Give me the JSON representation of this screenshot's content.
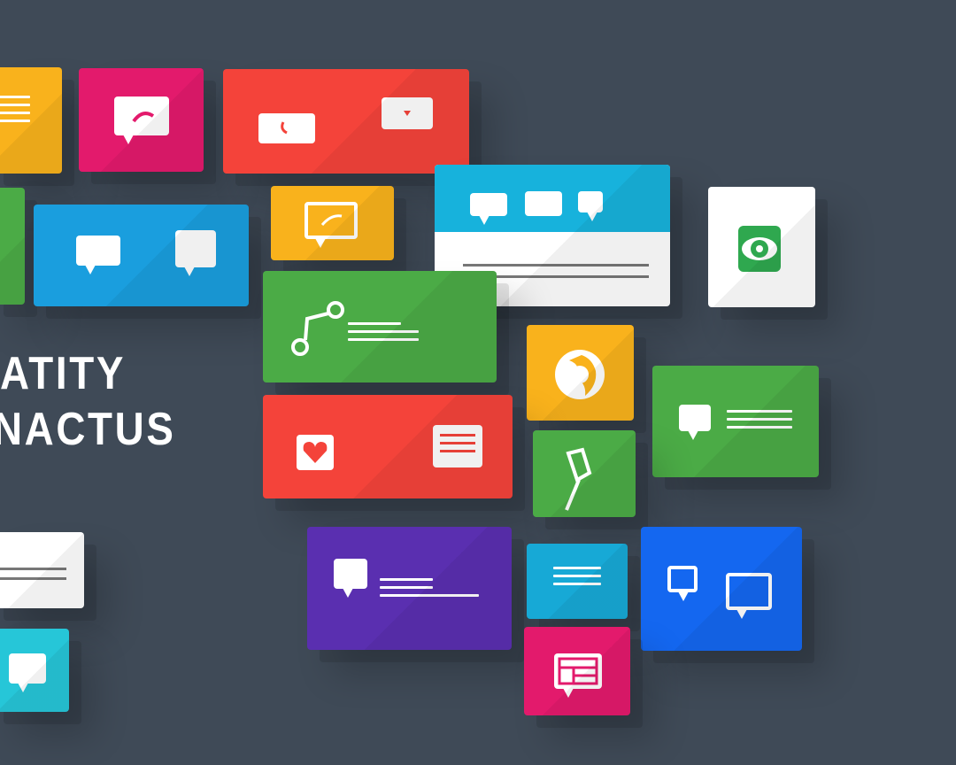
{
  "headline": {
    "line1": "ATITY",
    "line2": "NACTUS"
  },
  "colors": {
    "background": "#3f4a57",
    "yellow": "#f9b21c",
    "magenta": "#e31a6c",
    "red": "#f4433a",
    "blue": "#1a9ede",
    "green": "#4bab46",
    "white": "#ffffff",
    "purple": "#5a2fb0",
    "cyan": "#17a9d6",
    "bright_blue": "#1467f0",
    "teal": "#26c6d8"
  },
  "tiles": [
    {
      "name": "yellow-lines-tile",
      "icon": "text-lines-icon"
    },
    {
      "name": "magenta-chat-tile",
      "icon": "chat-bubble-icon"
    },
    {
      "name": "red-two-bubbles-tile",
      "icon": "message-card-icon"
    },
    {
      "name": "green-edge-tile",
      "icon": ""
    },
    {
      "name": "blue-chat-tile",
      "icon": "chat-bubble-icon"
    },
    {
      "name": "yellow-chat-tile",
      "icon": "chat-bubble-icon"
    },
    {
      "name": "white-cyan-card-tile",
      "icon": "chat-bubble-icon"
    },
    {
      "name": "white-eye-tile",
      "icon": "eye-icon"
    },
    {
      "name": "green-share-tile",
      "icon": "share-node-icon"
    },
    {
      "name": "yellow-globe-tile",
      "icon": "globe-icon"
    },
    {
      "name": "green-chat-lines-tile",
      "icon": "chat-bubble-icon"
    },
    {
      "name": "red-heart-tile",
      "icon": "heart-icon"
    },
    {
      "name": "green-pen-tile",
      "icon": "pen-icon"
    },
    {
      "name": "white-lines-tile",
      "icon": "text-lines-icon"
    },
    {
      "name": "purple-chat-tile",
      "icon": "chat-bubble-icon"
    },
    {
      "name": "cyan-lines-tile",
      "icon": "text-lines-icon"
    },
    {
      "name": "blue-double-chat-tile",
      "icon": "chat-bubble-icon"
    },
    {
      "name": "teal-chat-tile",
      "icon": "chat-bubble-icon"
    },
    {
      "name": "magenta-calendar-tile",
      "icon": "calendar-icon"
    }
  ]
}
